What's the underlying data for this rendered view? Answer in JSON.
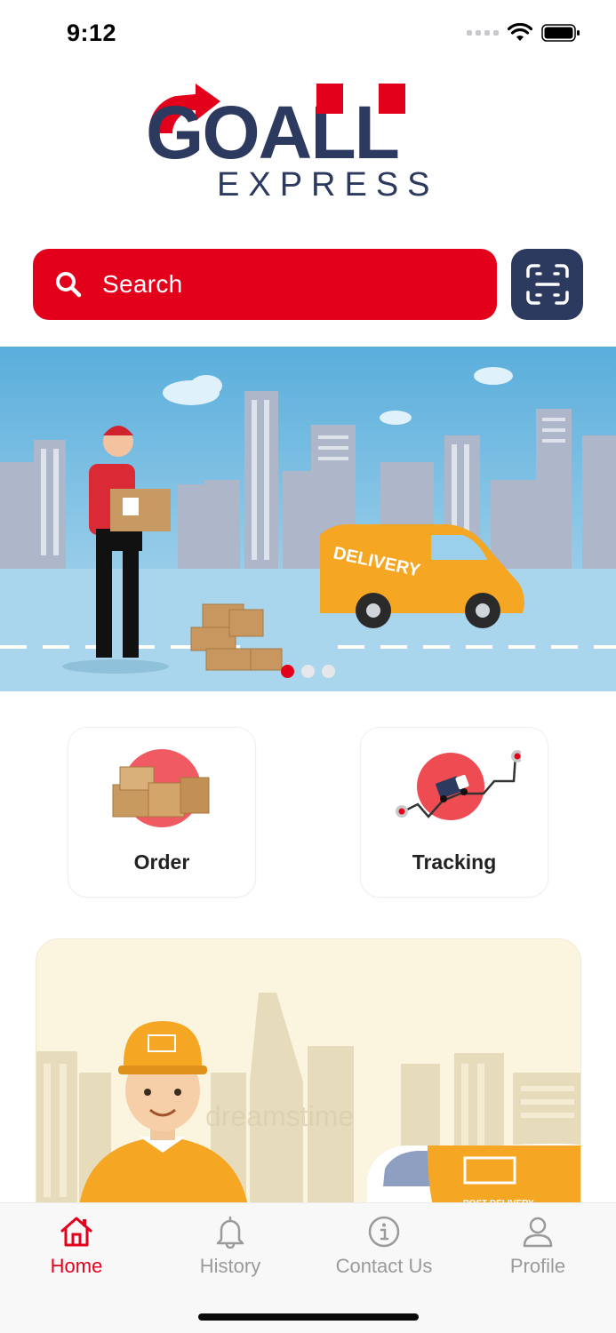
{
  "status_bar": {
    "time": "9:12"
  },
  "logo": {
    "brand": "GOALL",
    "tagline": "EXPRESS"
  },
  "search": {
    "placeholder": "Search"
  },
  "carousel": {
    "active_index": 0,
    "count": 3,
    "banner_van_text": "DELIVERY"
  },
  "services": [
    {
      "label": "Order",
      "icon": "order-boxes-icon"
    },
    {
      "label": "Tracking",
      "icon": "tracking-route-icon"
    }
  ],
  "promo": {
    "van_text": "POST DELIVERY",
    "watermark": "dreamstime"
  },
  "tab_bar": {
    "items": [
      {
        "label": "Home",
        "icon": "home-icon",
        "active": true
      },
      {
        "label": "History",
        "icon": "bell-icon",
        "active": false
      },
      {
        "label": "Contact Us",
        "icon": "info-icon",
        "active": false
      },
      {
        "label": "Profile",
        "icon": "person-icon",
        "active": false
      }
    ]
  },
  "colors": {
    "accent": "#e3001b",
    "navy": "#2b3a5e",
    "inactive": "#9a9a9a"
  }
}
